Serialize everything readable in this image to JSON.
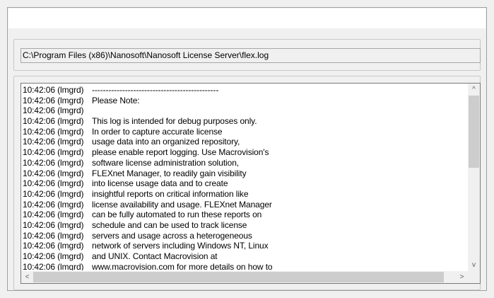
{
  "path_field": {
    "value": "C:\\Program Files (x86)\\Nanosoft\\Nanosoft License Server\\flex.log"
  },
  "log": {
    "lines": [
      {
        "ts": "10:42:06 (lmgrd)",
        "msg": "----------------------------------------------"
      },
      {
        "ts": "10:42:06 (lmgrd)",
        "msg": "Please Note:"
      },
      {
        "ts": "10:42:06 (lmgrd)",
        "msg": ""
      },
      {
        "ts": "10:42:06 (lmgrd)",
        "msg": "This log is intended for debug purposes only."
      },
      {
        "ts": "10:42:06 (lmgrd)",
        "msg": "In order to capture accurate license"
      },
      {
        "ts": "10:42:06 (lmgrd)",
        "msg": "usage data into an organized repository,"
      },
      {
        "ts": "10:42:06 (lmgrd)",
        "msg": "please enable report logging. Use Macrovision's"
      },
      {
        "ts": "10:42:06 (lmgrd)",
        "msg": "software license administration  solution,"
      },
      {
        "ts": "10:42:06 (lmgrd)",
        "msg": "FLEXnet Manager, to  readily gain visibility"
      },
      {
        "ts": "10:42:06 (lmgrd)",
        "msg": "into license usage data and to create"
      },
      {
        "ts": "10:42:06 (lmgrd)",
        "msg": "insightful reports on critical information like"
      },
      {
        "ts": "10:42:06 (lmgrd)",
        "msg": "license availability and usage. FLEXnet Manager"
      },
      {
        "ts": "10:42:06 (lmgrd)",
        "msg": "can be fully automated to run these reports on"
      },
      {
        "ts": "10:42:06 (lmgrd)",
        "msg": "schedule and can be used to track license"
      },
      {
        "ts": "10:42:06 (lmgrd)",
        "msg": "servers and usage across a heterogeneous"
      },
      {
        "ts": "10:42:06 (lmgrd)",
        "msg": "network of servers including Windows NT, Linux"
      },
      {
        "ts": "10:42:06 (lmgrd)",
        "msg": "and UNIX. Contact Macrovision at"
      },
      {
        "ts": "10:42:06 (lmgrd)",
        "msg": "www.macrovision.com for more details on how to"
      }
    ]
  },
  "scrollbars": {
    "up_icon": "^",
    "down_icon": "v",
    "left_icon": "<",
    "right_icon": ">"
  }
}
